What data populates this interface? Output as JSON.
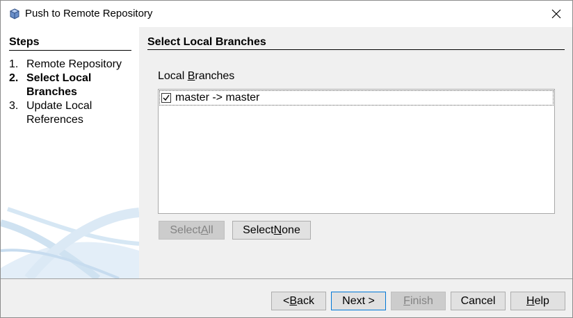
{
  "window": {
    "title": "Push to Remote Repository",
    "icon": "git-repository-icon"
  },
  "steps": {
    "heading": "Steps",
    "items": [
      {
        "number": "1.",
        "label": "Remote Repository",
        "current": false
      },
      {
        "number": "2.",
        "label": "Select Local Branches",
        "current": true
      },
      {
        "number": "3.",
        "label": "Update Local References",
        "current": false
      }
    ]
  },
  "main": {
    "title": "Select Local Branches",
    "branches_label_prefix": "Local ",
    "branches_label_mnemonic": "B",
    "branches_label_suffix": "ranches",
    "branches": [
      {
        "label": "master -> master",
        "checked": true
      }
    ],
    "select_all": {
      "prefix": "Select ",
      "mnemonic": "A",
      "suffix": "ll",
      "enabled": false
    },
    "select_none": {
      "prefix": "Select ",
      "mnemonic": "N",
      "suffix": "one",
      "enabled": true
    }
  },
  "footer": {
    "back": {
      "prefix": "< ",
      "mnemonic": "B",
      "suffix": "ack"
    },
    "next": {
      "label": "Next >"
    },
    "finish": {
      "prefix": "",
      "mnemonic": "F",
      "suffix": "inish",
      "enabled": false
    },
    "cancel": {
      "label": "Cancel"
    },
    "help": {
      "prefix": "",
      "mnemonic": "H",
      "suffix": "elp"
    }
  },
  "colors": {
    "accent": "#0078d7",
    "decor_blue": "#cfe2f1"
  }
}
